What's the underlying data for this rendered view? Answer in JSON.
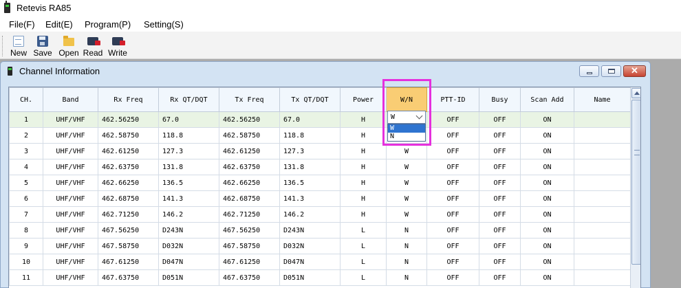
{
  "app": {
    "title": "Retevis RA85"
  },
  "menu": [
    "File(F)",
    "Edit(E)",
    "Program(P)",
    "Setting(S)"
  ],
  "toolbar": [
    {
      "label": "New",
      "icon": "new-document-icon"
    },
    {
      "label": "Save",
      "icon": "floppy-disk-icon"
    },
    {
      "label": "Open",
      "icon": "folder-open-icon"
    },
    {
      "label": "Read",
      "icon": "read-radio-icon"
    },
    {
      "label": "Write",
      "icon": "write-radio-icon"
    }
  ],
  "window": {
    "title": "Channel Information",
    "buttons": {
      "minimize": "▭",
      "maximize": "□",
      "close": "✕"
    }
  },
  "table": {
    "columns": [
      "CH.",
      "Band",
      "Rx Freq",
      "Rx QT/DQT",
      "Tx Freq",
      "Tx QT/DQT",
      "Power",
      "W/N",
      "PTT-ID",
      "Busy",
      "Scan Add",
      "Name"
    ],
    "selected_column": "W/N",
    "rows": [
      [
        "1",
        "UHF/VHF",
        "462.56250",
        "67.0",
        "462.56250",
        "67.0",
        "H",
        "W",
        "OFF",
        "OFF",
        "ON",
        ""
      ],
      [
        "2",
        "UHF/VHF",
        "462.58750",
        "118.8",
        "462.58750",
        "118.8",
        "H",
        "W",
        "OFF",
        "OFF",
        "ON",
        ""
      ],
      [
        "3",
        "UHF/VHF",
        "462.61250",
        "127.3",
        "462.61250",
        "127.3",
        "H",
        "W",
        "OFF",
        "OFF",
        "ON",
        ""
      ],
      [
        "4",
        "UHF/VHF",
        "462.63750",
        "131.8",
        "462.63750",
        "131.8",
        "H",
        "W",
        "OFF",
        "OFF",
        "ON",
        ""
      ],
      [
        "5",
        "UHF/VHF",
        "462.66250",
        "136.5",
        "462.66250",
        "136.5",
        "H",
        "W",
        "OFF",
        "OFF",
        "ON",
        ""
      ],
      [
        "6",
        "UHF/VHF",
        "462.68750",
        "141.3",
        "462.68750",
        "141.3",
        "H",
        "W",
        "OFF",
        "OFF",
        "ON",
        ""
      ],
      [
        "7",
        "UHF/VHF",
        "462.71250",
        "146.2",
        "462.71250",
        "146.2",
        "H",
        "W",
        "OFF",
        "OFF",
        "ON",
        ""
      ],
      [
        "8",
        "UHF/VHF",
        "467.56250",
        "D243N",
        "467.56250",
        "D243N",
        "L",
        "N",
        "OFF",
        "OFF",
        "ON",
        ""
      ],
      [
        "9",
        "UHF/VHF",
        "467.58750",
        "D032N",
        "467.58750",
        "D032N",
        "L",
        "N",
        "OFF",
        "OFF",
        "ON",
        ""
      ],
      [
        "10",
        "UHF/VHF",
        "467.61250",
        "D047N",
        "467.61250",
        "D047N",
        "L",
        "N",
        "OFF",
        "OFF",
        "ON",
        ""
      ],
      [
        "11",
        "UHF/VHF",
        "467.63750",
        "D051N",
        "467.63750",
        "D051N",
        "L",
        "N",
        "OFF",
        "OFF",
        "ON",
        ""
      ]
    ]
  },
  "wn_editor": {
    "value": "W",
    "options": [
      "W",
      "N"
    ],
    "highlighted_option": "W"
  },
  "colors": {
    "selected_header": "#f9cd74",
    "row_highlight": "#e9f4e4",
    "annotation_box": "#e530dd",
    "dropdown_selection": "#2f74d0"
  }
}
